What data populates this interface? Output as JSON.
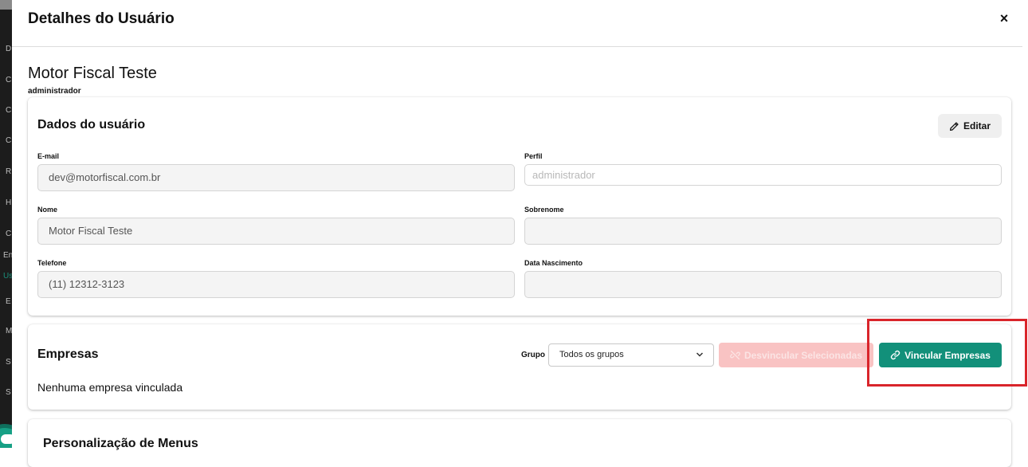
{
  "sidebar": {
    "items": [
      "D",
      "C",
      "C",
      "C",
      "R",
      "H",
      "C",
      "En",
      "Us",
      "E",
      "M",
      "S",
      "S"
    ],
    "active_index": 8
  },
  "modal": {
    "title": "Detalhes do Usuário",
    "close_label": "×"
  },
  "user": {
    "name": "Motor Fiscal Teste",
    "role": "administrador"
  },
  "dados": {
    "title": "Dados do usuário",
    "edit_label": "Editar",
    "fields": {
      "email": {
        "label": "E-mail",
        "value": "dev@motorfiscal.com.br"
      },
      "perfil": {
        "label": "Perfil",
        "value": "administrador"
      },
      "nome": {
        "label": "Nome",
        "value": "Motor Fiscal Teste"
      },
      "sobrenome": {
        "label": "Sobrenome",
        "value": ""
      },
      "telefone": {
        "label": "Telefone",
        "value": "(11) 12312-3123"
      },
      "data_nascimento": {
        "label": "Data Nascimento",
        "value": ""
      }
    }
  },
  "empresas": {
    "title": "Empresas",
    "grupo_label": "Grupo",
    "grupo_selected": "Todos os grupos",
    "unlink_label": "Desvincular Selecionadas",
    "link_label": "Vincular Empresas",
    "empty_text": "Nenhuma empresa vinculada"
  },
  "menus": {
    "title": "Personalização de Menus"
  },
  "colors": {
    "accent": "#12907a",
    "danger_light": "#f9c3c3",
    "highlight": "#d9252b"
  }
}
